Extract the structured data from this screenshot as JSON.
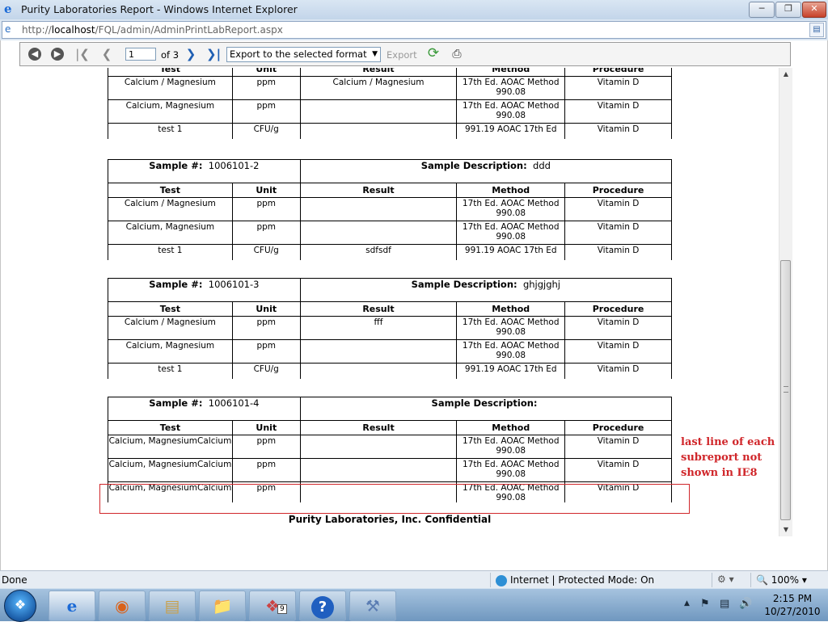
{
  "window": {
    "title": "Purity Laboratories Report - Windows Internet Explorer",
    "url_prefix": "http://",
    "url_host": "localhost",
    "url_path": "/FQL/admin/AdminPrintLabReport.aspx"
  },
  "viewer": {
    "page_value": "1",
    "page_of": "of 3",
    "export_format": "Export to the selected format",
    "export_label": "Export"
  },
  "report": {
    "columns": [
      "Test",
      "Unit",
      "Result",
      "Method",
      "Procedure"
    ],
    "first_block_rows": [
      {
        "test": "Calcium / Magnesium",
        "unit": "ppm",
        "result": "Calcium / Magnesium",
        "method": "17th Ed. AOAC Method 990.08",
        "procedure": "Vitamin D"
      },
      {
        "test": "Calcium, Magnesium",
        "unit": "ppm",
        "result": "",
        "method": "17th Ed. AOAC Method 990.08",
        "procedure": "Vitamin D"
      },
      {
        "test": "test 1",
        "unit": "CFU/g",
        "result": "",
        "method": "991.19 AOAC 17th Ed",
        "procedure": "Vitamin D"
      }
    ],
    "samples": [
      {
        "sample_label": "Sample #:",
        "sample_no": "1006101-2",
        "desc_label": "Sample Description:",
        "desc": "ddd",
        "rows": [
          {
            "test": "Calcium / Magnesium",
            "unit": "ppm",
            "result": "",
            "method": "17th Ed. AOAC Method 990.08",
            "procedure": "Vitamin D"
          },
          {
            "test": "Calcium, Magnesium",
            "unit": "ppm",
            "result": "",
            "method": "17th Ed. AOAC Method 990.08",
            "procedure": "Vitamin D"
          },
          {
            "test": "test 1",
            "unit": "CFU/g",
            "result": "sdfsdf",
            "method": "991.19 AOAC 17th Ed",
            "procedure": "Vitamin D"
          }
        ]
      },
      {
        "sample_label": "Sample #:",
        "sample_no": "1006101-3",
        "desc_label": "Sample Description:",
        "desc": "ghjgjghj",
        "rows": [
          {
            "test": "Calcium / Magnesium",
            "unit": "ppm",
            "result": "fff",
            "method": "17th Ed. AOAC Method 990.08",
            "procedure": "Vitamin D"
          },
          {
            "test": "Calcium, Magnesium",
            "unit": "ppm",
            "result": "",
            "method": "17th Ed. AOAC Method 990.08",
            "procedure": "Vitamin D"
          },
          {
            "test": "test 1",
            "unit": "CFU/g",
            "result": "",
            "method": "991.19 AOAC 17th Ed",
            "procedure": "Vitamin D"
          }
        ]
      },
      {
        "sample_label": "Sample #:",
        "sample_no": "1006101-4",
        "desc_label": "Sample Description:",
        "desc": "",
        "rows": [
          {
            "test": "Calcium, MagnesiumCalcium",
            "unit": "ppm",
            "result": "",
            "method": "17th Ed. AOAC Method 990.08",
            "procedure": "Vitamin D"
          },
          {
            "test": "Calcium, MagnesiumCalcium",
            "unit": "ppm",
            "result": "",
            "method": "17th Ed. AOAC Method 990.08",
            "procedure": "Vitamin D"
          },
          {
            "test": "Calcium, MagnesiumCalcium",
            "unit": "ppm",
            "result": "",
            "method": "17th Ed. AOAC Method 990.08",
            "procedure": "Vitamin D"
          }
        ]
      }
    ],
    "footer": "Purity Laboratories, Inc. Confidential"
  },
  "annotation": {
    "note": "last line of each subreport not shown in IE8",
    "color": "#d0262a"
  },
  "status": {
    "left": "Done",
    "zone": "Internet | Protected Mode: On",
    "zoom": "100%"
  },
  "taskbar": {
    "time": "2:15 PM",
    "date": "10/27/2010",
    "badge": "9"
  }
}
